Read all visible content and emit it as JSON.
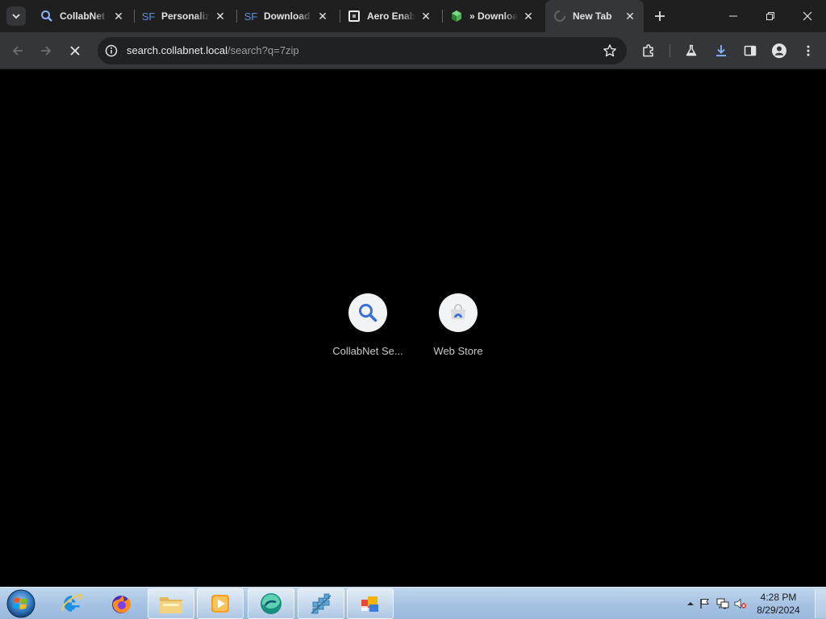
{
  "browser": {
    "tabs": [
      {
        "title": "CollabNet",
        "icon": "search-icon",
        "favicon_text": ""
      },
      {
        "title": "Personaliz",
        "icon": "sourceforge-icon",
        "favicon_text": "SF"
      },
      {
        "title": "Download",
        "icon": "sourceforge-icon",
        "favicon_text": "SF"
      },
      {
        "title": "Aero Enabl",
        "icon": "app-icon",
        "favicon_text": ""
      },
      {
        "title": "» Downloa",
        "icon": "cube-icon",
        "favicon_text": ""
      },
      {
        "title": "New Tab",
        "icon": "loading-icon",
        "favicon_text": "",
        "active": true
      }
    ],
    "omnibox": {
      "host": "search.collabnet.local",
      "path": "/search?q=7zip"
    },
    "accent_color": "#8ab4f8"
  },
  "new_tab_page": {
    "shortcuts": [
      {
        "label": "CollabNet Se...",
        "icon": "search-icon"
      },
      {
        "label": "Web Store",
        "icon": "web-store-icon"
      }
    ]
  },
  "taskbar": {
    "pinned_apps": [
      "internet-explorer-icon",
      "firefox-icon",
      "file-explorer-icon",
      "media-player-icon",
      "edge-browser-icon",
      "network-icon",
      "office-icon"
    ],
    "clock": {
      "time": "4:28 PM",
      "date": "8/29/2024"
    }
  }
}
